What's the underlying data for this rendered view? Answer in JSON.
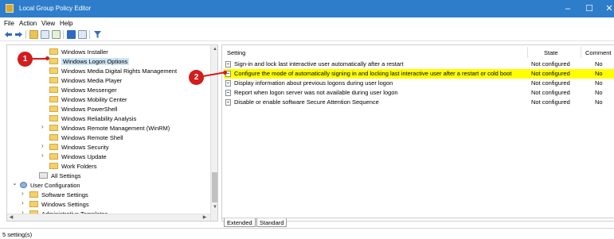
{
  "window": {
    "title": "Local Group Policy Editor",
    "minimize": "–",
    "maximize": "☐",
    "close": "✕"
  },
  "menu": [
    "File",
    "Action",
    "View",
    "Help"
  ],
  "tree": {
    "items": [
      {
        "label": "Windows Installer",
        "expandable": false
      },
      {
        "label": "Windows Logon Options",
        "expandable": false,
        "selected": true
      },
      {
        "label": "Windows Media Digital Rights Management",
        "expandable": false
      },
      {
        "label": "Windows Media Player",
        "expandable": false
      },
      {
        "label": "Windows Messenger",
        "expandable": false
      },
      {
        "label": "Windows Mobility Center",
        "expandable": false
      },
      {
        "label": "Windows PowerShell",
        "expandable": false
      },
      {
        "label": "Windows Reliability Analysis",
        "expandable": false
      },
      {
        "label": "Windows Remote Management (WinRM)",
        "expandable": true
      },
      {
        "label": "Windows Remote Shell",
        "expandable": false
      },
      {
        "label": "Windows Security",
        "expandable": true
      },
      {
        "label": "Windows Update",
        "expandable": true
      },
      {
        "label": "Work Folders",
        "expandable": false
      },
      {
        "label": "All Settings",
        "expandable": false
      },
      {
        "label": "User Configuration",
        "expandable": true
      },
      {
        "label": "Software Settings",
        "expandable": true
      },
      {
        "label": "Windows Settings",
        "expandable": true
      },
      {
        "label": "Administrative Templates",
        "expandable": true
      }
    ]
  },
  "list": {
    "headers": {
      "setting": "Setting",
      "state": "State",
      "comment": "Comment"
    },
    "rows": [
      {
        "setting": "Sign-in and lock last interactive user automatically after a restart",
        "state": "Not configured",
        "comment": "No",
        "highlighted": false
      },
      {
        "setting": "Configure the mode of automatically signing in and locking last interactive user after a restart or cold boot",
        "state": "Not configured",
        "comment": "No",
        "highlighted": true
      },
      {
        "setting": "Display information about previous logons during user logon",
        "state": "Not configured",
        "comment": "No",
        "highlighted": false
      },
      {
        "setting": "Report when logon server was not available during user logon",
        "state": "Not configured",
        "comment": "No",
        "highlighted": false
      },
      {
        "setting": "Disable or enable software Secure Attention Sequence",
        "state": "Not configured",
        "comment": "No",
        "highlighted": false
      }
    ]
  },
  "tabs": [
    "Extended",
    "Standard"
  ],
  "status": {
    "text": "5 setting(s)"
  },
  "callouts": [
    "1",
    "2"
  ],
  "colors": {
    "titlebar": "#2e7dcb",
    "highlight": "#ffff00",
    "callout": "#d31c1c",
    "selection": "#cce4f7"
  },
  "icons": [
    "back-arrow-icon",
    "forward-arrow-icon",
    "up-folder-icon",
    "show-hide-tree-icon",
    "export-list-icon",
    "help-icon",
    "properties-icon",
    "filter-icon"
  ]
}
